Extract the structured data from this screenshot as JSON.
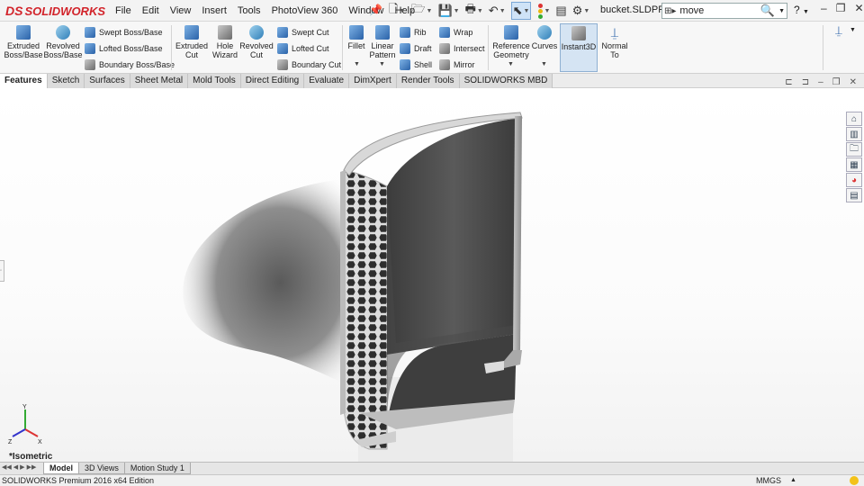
{
  "app": {
    "logo_ds": "DS",
    "logo_text": "SOLIDWORKS"
  },
  "menu": [
    "File",
    "Edit",
    "View",
    "Insert",
    "Tools",
    "PhotoView 360",
    "Window",
    "Help"
  ],
  "document": {
    "name": "bucket.SLDPRT *"
  },
  "search": {
    "value": "move"
  },
  "help_label": "?",
  "features": {
    "extruded_boss": "Extruded Boss/Base",
    "revolved_boss": "Revolved Boss/Base",
    "swept_boss": "Swept Boss/Base",
    "lofted_boss": "Lofted Boss/Base",
    "boundary_boss": "Boundary Boss/Base",
    "extruded_cut": "Extruded Cut",
    "hole_wizard": "Hole Wizard",
    "revolved_cut": "Revolved Cut",
    "swept_cut": "Swept Cut",
    "lofted_cut": "Lofted Cut",
    "boundary_cut": "Boundary Cut",
    "fillet": "Fillet",
    "linear_pattern": "Linear Pattern",
    "rib": "Rib",
    "draft": "Draft",
    "shell": "Shell",
    "wrap": "Wrap",
    "intersect": "Intersect",
    "mirror": "Mirror",
    "reference_geometry": "Reference Geometry",
    "curves": "Curves",
    "instant3d": "Instant3D",
    "normal_to": "Normal To"
  },
  "tabs": [
    "Features",
    "Sketch",
    "Surfaces",
    "Sheet Metal",
    "Mold Tools",
    "Direct Editing",
    "Evaluate",
    "DimXpert",
    "Render Tools",
    "SOLIDWORKS MBD"
  ],
  "viewport": {
    "view_label": "*Isometric",
    "triad": {
      "x": "X",
      "y": "Y",
      "z": "Z"
    }
  },
  "model_tabs": [
    "Model",
    "3D Views",
    "Motion Study 1"
  ],
  "status": {
    "text": "SOLIDWORKS Premium 2016 x64 Edition",
    "units": "MMGS"
  },
  "colors": {
    "logo_red": "#d2232a",
    "accent_blue": "#2a62a8",
    "selection_bg": "#d5e4f3"
  }
}
